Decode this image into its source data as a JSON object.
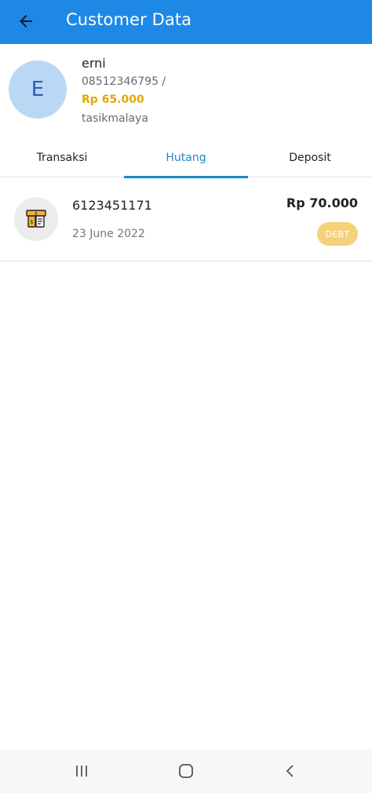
{
  "appbar": {
    "title": "Customer Data",
    "back_icon": "arrow-left-icon",
    "color": "#1e88e5"
  },
  "customer": {
    "initial": "E",
    "name": "erni",
    "phone": "08512346795 /",
    "balance": "Rp 65.000",
    "city": "tasikmalaya"
  },
  "tabs": [
    {
      "label": "Transaksi",
      "active": false
    },
    {
      "label": "Hutang",
      "active": true
    },
    {
      "label": "Deposit",
      "active": false
    }
  ],
  "transactions": [
    {
      "icon": "money-document-icon",
      "number": "6123451171",
      "date": "23 June 2022",
      "amount": "Rp 70.000",
      "badge": "DEBT"
    }
  ],
  "navbar": {
    "recents_icon": "recent-apps-icon",
    "home_icon": "home-icon",
    "back_icon": "nav-back-icon"
  }
}
